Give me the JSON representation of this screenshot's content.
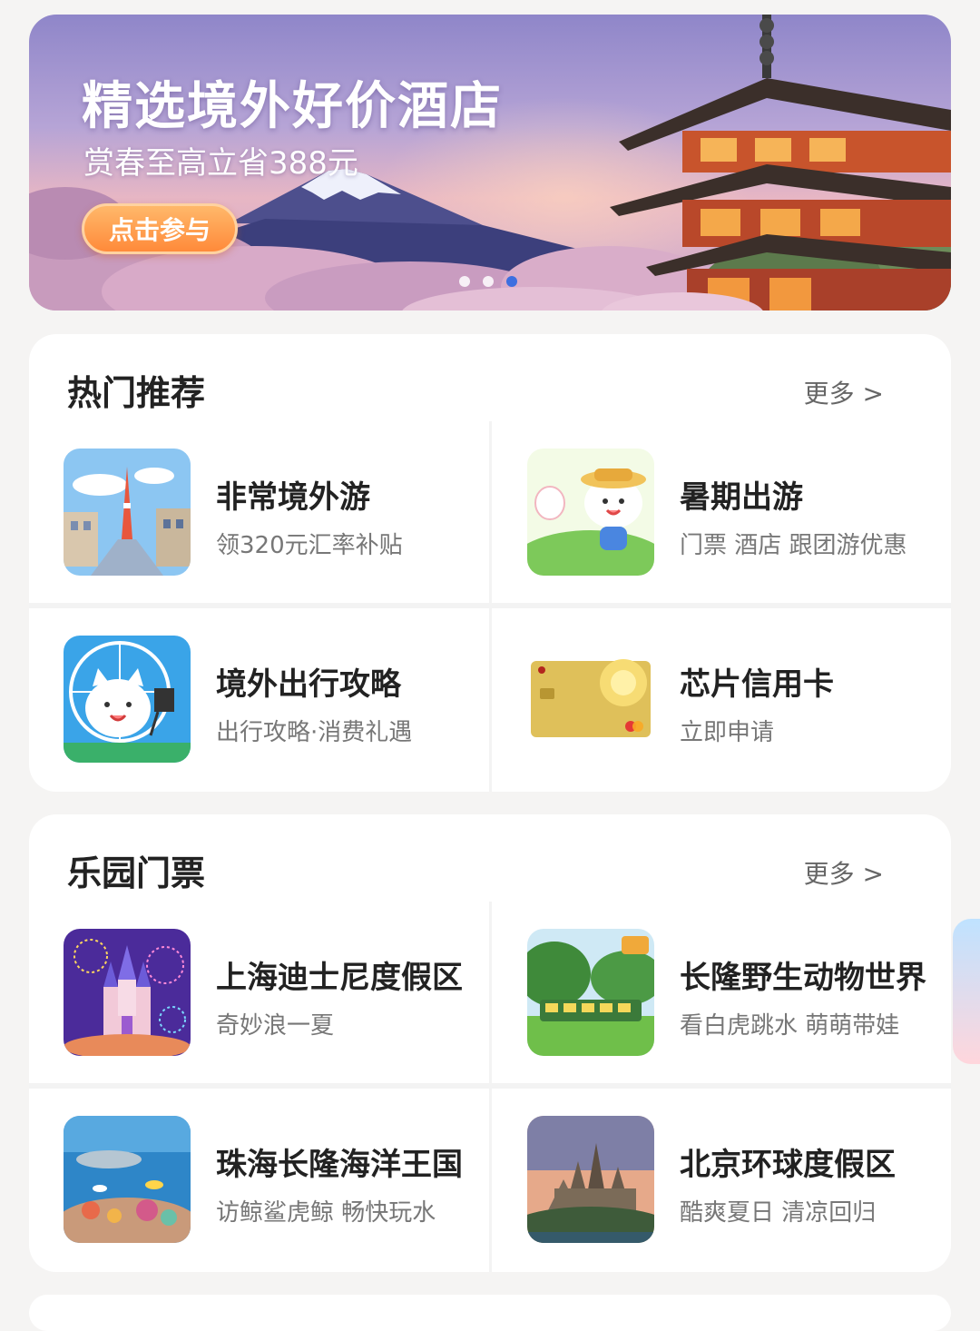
{
  "banner": {
    "title": "精选境外好价酒店",
    "subtitle": "赏春至高立省388元",
    "cta_label": "点击参与",
    "slides": 3,
    "active_slide": 3
  },
  "hot": {
    "title": "热门推荐",
    "more_label": "更多 >",
    "items": [
      {
        "name": "非常境外游",
        "desc": "领320元汇率补贴",
        "icon": "city-tower-thumbnail"
      },
      {
        "name": "暑期出游",
        "desc": "门票 酒店 跟团游优惠",
        "icon": "cartoon-cat-summer-thumbnail"
      },
      {
        "name": "境外出行攻略",
        "desc": "出行攻略·消费礼遇",
        "icon": "cartoon-cat-ferris-wheel-thumbnail"
      },
      {
        "name": "芯片信用卡",
        "desc": "立即申请",
        "icon": "gold-credit-card-thumbnail"
      }
    ]
  },
  "park": {
    "title": "乐园门票",
    "more_label": "更多 >",
    "items": [
      {
        "name": "上海迪士尼度假区",
        "desc": "奇妙浪一夏",
        "icon": "castle-fireworks-thumbnail"
      },
      {
        "name": "长隆野生动物世界",
        "desc": "看白虎跳水 萌萌带娃",
        "icon": "safari-train-thumbnail"
      },
      {
        "name": "珠海长隆海洋王国",
        "desc": "访鲸鲨虎鲸 畅快玩水",
        "icon": "ocean-reef-thumbnail"
      },
      {
        "name": "北京环球度假区",
        "desc": "酷爽夏日 清凉回归",
        "icon": "hogwarts-castle-thumbnail"
      }
    ]
  },
  "colors": {
    "accent_orange": "#ff8a3a",
    "dot_active": "#3d6fe0",
    "text_primary": "#222222",
    "text_secondary": "#777777"
  }
}
